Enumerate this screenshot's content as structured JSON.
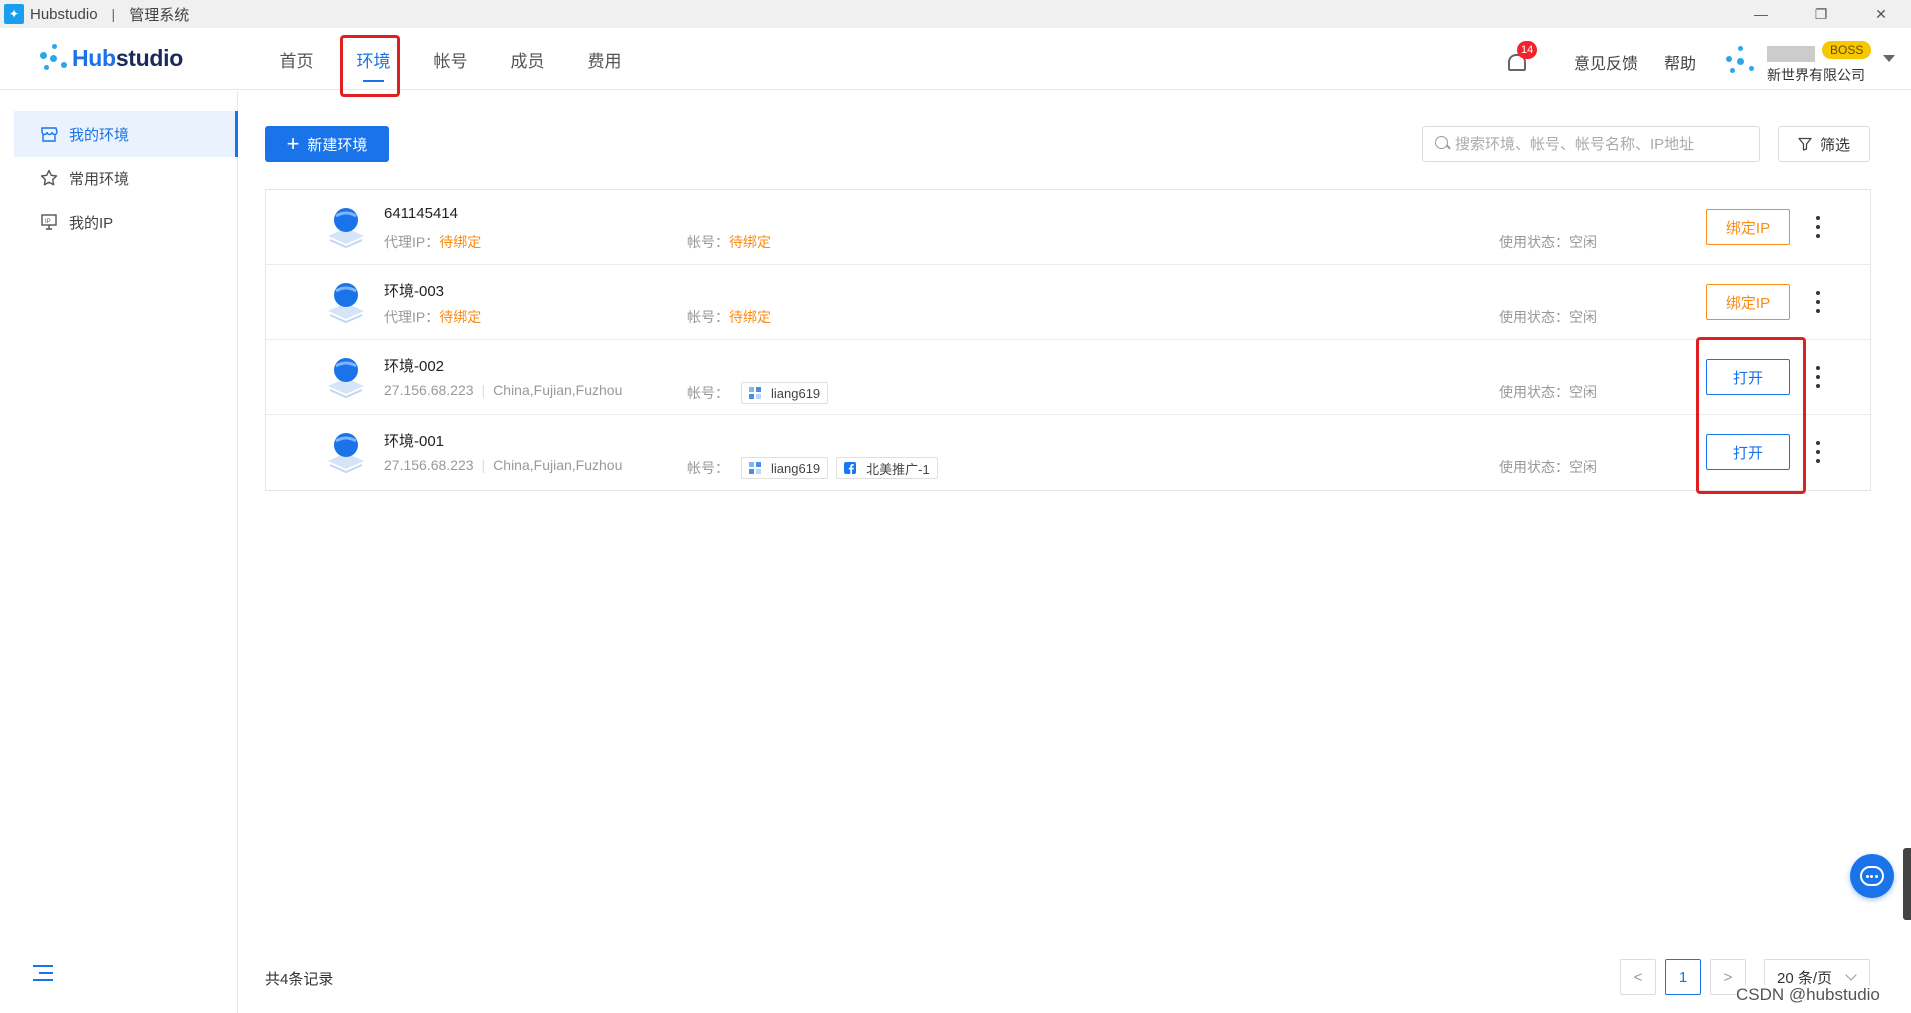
{
  "titlebar": {
    "app_name": "Hubstudio",
    "separator": "|",
    "subtitle": "管理系统",
    "minimize": "—",
    "restore": "❐",
    "close": "✕"
  },
  "header": {
    "logo_hub": "Hub",
    "logo_studio": "studio",
    "nav": [
      {
        "label": "首页",
        "active": false
      },
      {
        "label": "环境",
        "active": true
      },
      {
        "label": "帐号",
        "active": false
      },
      {
        "label": "成员",
        "active": false
      },
      {
        "label": "费用",
        "active": false
      }
    ],
    "notification_count": "14",
    "feedback": "意见反馈",
    "help": "帮助",
    "role_badge": "BOSS",
    "company": "新世界有限公司"
  },
  "sidebar": {
    "items": [
      {
        "label": "我的环境",
        "icon": "shop-icon",
        "active": true
      },
      {
        "label": "常用环境",
        "icon": "star-icon",
        "active": false
      },
      {
        "label": "我的IP",
        "icon": "ip-monitor-icon",
        "active": false
      }
    ]
  },
  "toolbar": {
    "new_env_label": "新建环境",
    "search_placeholder": "搜索环境、帐号、帐号名称、IP地址",
    "filter_label": "筛选"
  },
  "environments": [
    {
      "name": "641145414",
      "proxy_label": "代理IP：",
      "proxy_value": "待绑定",
      "account_label": "帐号：",
      "account_value": "待绑定",
      "status_label": "使用状态：",
      "status_value": "空闲",
      "action": "绑定IP"
    },
    {
      "name": "环境-003",
      "proxy_label": "代理IP：",
      "proxy_value": "待绑定",
      "account_label": "帐号：",
      "account_value": "待绑定",
      "status_label": "使用状态：",
      "status_value": "空闲",
      "action": "绑定IP"
    },
    {
      "name": "环境-002",
      "ip": "27.156.68.223",
      "location": "China,Fujian,Fuzhou",
      "account_label": "帐号：",
      "accounts": [
        {
          "label": "liang619",
          "icon": "account-grid-icon"
        }
      ],
      "status_label": "使用状态：",
      "status_value": "空闲",
      "action": "打开"
    },
    {
      "name": "环境-001",
      "ip": "27.156.68.223",
      "location": "China,Fujian,Fuzhou",
      "account_label": "帐号：",
      "accounts": [
        {
          "label": "liang619",
          "icon": "account-grid-icon"
        },
        {
          "label": "北美推广-1",
          "icon": "facebook-icon"
        }
      ],
      "status_label": "使用状态：",
      "status_value": "空闲",
      "action": "打开"
    }
  ],
  "footer": {
    "total": "共4条记录",
    "prev": "<",
    "page": "1",
    "next": ">",
    "page_size": "20 条/页"
  },
  "watermark": "CSDN @hubstudio",
  "colors": {
    "primary": "#1a73e8",
    "warning": "#fa8c16",
    "highlight": "#e02020"
  }
}
